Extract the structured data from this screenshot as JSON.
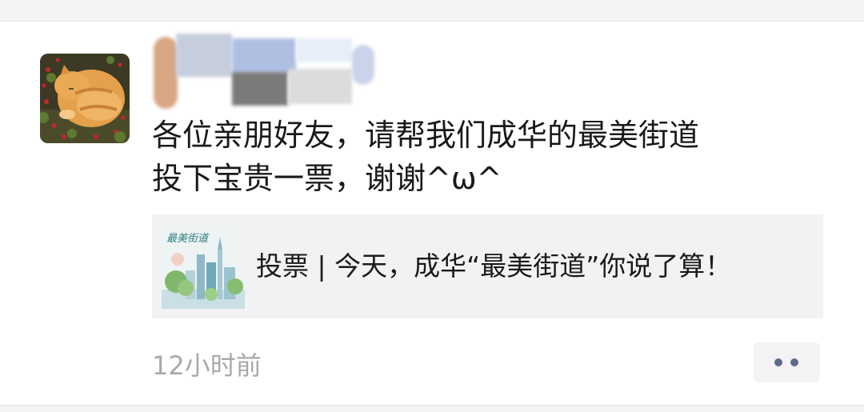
{
  "post": {
    "text_line1": "各位亲朋好友，请帮我们成华的最美街道",
    "text_line2": "投下宝贵一票，谢谢^ω^",
    "timestamp": "12小时前"
  },
  "link_card": {
    "title": "投票 | 今天，成华“最美街道”你说了算！",
    "thumbnail_logo_text": "最美街道"
  },
  "colors": {
    "card_bg": "#f2f2f4",
    "timestamp": "#a8a8ad",
    "more_dots": "#5f6a8a"
  },
  "icons": {
    "more": "more-dots-icon",
    "avatar": "cat-avatar-icon"
  }
}
